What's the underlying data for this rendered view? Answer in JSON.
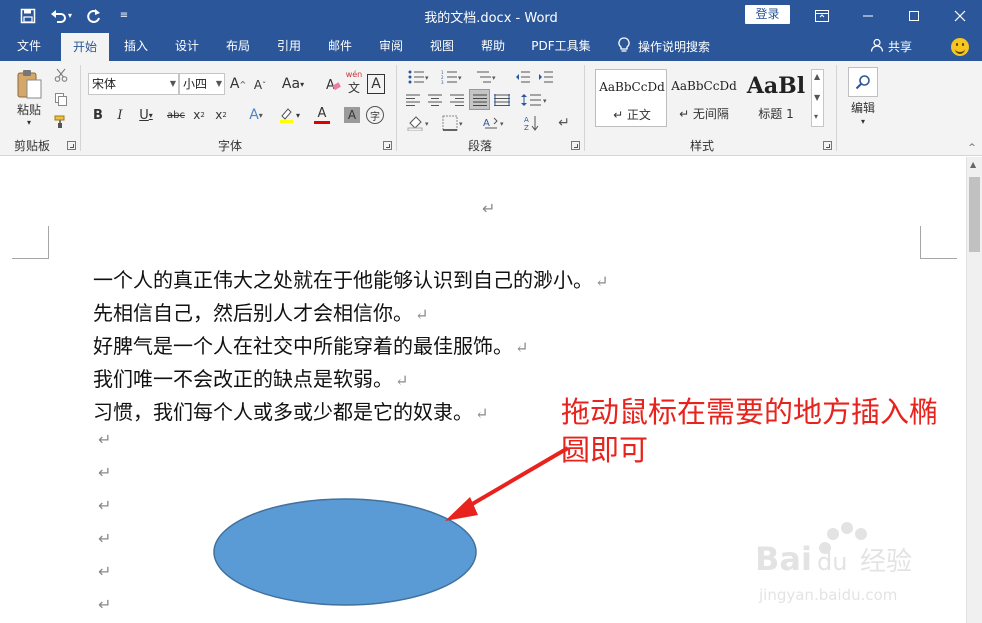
{
  "window": {
    "title": "我的文档.docx  -  Word",
    "login": "登录"
  },
  "tabs": [
    "文件",
    "开始",
    "插入",
    "设计",
    "布局",
    "引用",
    "邮件",
    "审阅",
    "视图",
    "帮助",
    "PDF工具集"
  ],
  "tell_me": "操作说明搜索",
  "share": "共享",
  "ribbon": {
    "clipboard": {
      "paste": "粘贴",
      "label": "剪贴板"
    },
    "font": {
      "name": "宋体",
      "size": "小四",
      "label": "字体",
      "Aa": "Aa",
      "A": "A"
    },
    "paragraph": {
      "label": "段落"
    },
    "styles": {
      "label": "样式",
      "items": [
        {
          "sample": "AaBbCcDd",
          "name": "↵ 正文"
        },
        {
          "sample": "AaBbCcDd",
          "name": "↵ 无间隔"
        },
        {
          "sample": "AaBl",
          "name": "标题 1"
        }
      ]
    },
    "editing": {
      "label": "编辑"
    }
  },
  "document": {
    "lines": [
      "一个人的真正伟大之处就在于他能够认识到自己的渺小。",
      "先相信自己，然后别人才会相信你。",
      "好脾气是一个人在社交中所能穿着的最佳服饰。",
      "我们唯一不会改正的缺点是软弱。",
      "习惯，我们每个人或多或少都是它的奴隶。"
    ],
    "paragraph_mark": "↵",
    "empty_paragraph_count": 6
  },
  "annotation": "拖动鼠标在需要的地方插入椭圆即可",
  "shape": {
    "type": "ellipse",
    "fill": "#5b9bd5",
    "stroke": "#41719c"
  },
  "colors": {
    "titlebar": "#2b579a",
    "ribbon": "#f3f3f3",
    "annotation": "#e8221c"
  }
}
